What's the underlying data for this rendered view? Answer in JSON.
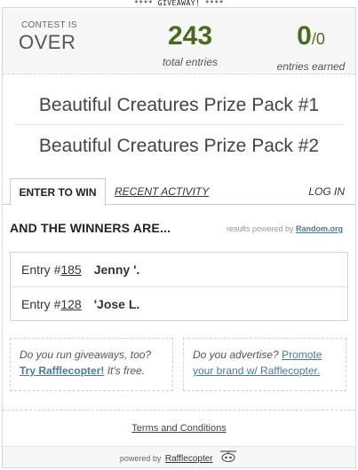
{
  "banner": "**** GIVEAWAY! ****",
  "stats": {
    "status_label": "CONTEST IS",
    "status_value": "OVER",
    "total_entries": "243",
    "total_caption": "total entries",
    "earned": "0",
    "earned_total": "/0",
    "earned_caption": "entries earned"
  },
  "prizes": [
    "Beautiful Creatures Prize Pack #1",
    "Beautiful Creatures Prize Pack #2"
  ],
  "tabs": {
    "enter": "ENTER TO WIN",
    "recent": "RECENT ACTIVITY",
    "login": "LOG IN"
  },
  "winners": {
    "heading": "AND THE WINNERS ARE...",
    "powered_text": "results powered by",
    "powered_link": "Random.org",
    "entries": [
      {
        "label": "Entry #",
        "number": "185",
        "name": "Jenny '."
      },
      {
        "label": "Entry #",
        "number": "128",
        "name": "'Jose L."
      }
    ]
  },
  "promo": {
    "left_question": "Do you run giveaways, too?",
    "left_link": "Try Rafflecopter!",
    "left_tail": "It's free.",
    "right_question": "Do you advertise?",
    "right_link": "Promote your brand w/ Rafflecopter."
  },
  "footer": {
    "terms": "Terms and Conditions",
    "powered_by": "powered by",
    "brand": "Rafflecopter",
    "logo_icon": "rafflecopter-logo-icon"
  }
}
